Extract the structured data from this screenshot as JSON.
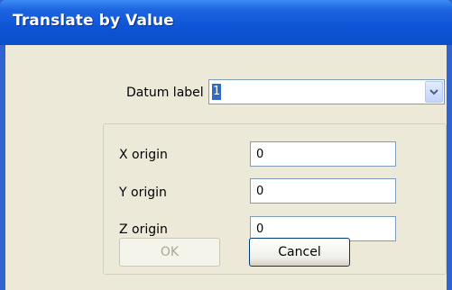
{
  "window": {
    "title": "Translate by Value"
  },
  "datum": {
    "label": "Datum label",
    "value": "1"
  },
  "origin": {
    "x_label": "X origin",
    "x_value": "0",
    "y_label": "Y origin",
    "y_value": "0",
    "z_label": "Z origin",
    "z_value": "0"
  },
  "buttons": {
    "ok_label": "OK",
    "cancel_label": "Cancel"
  },
  "icons": {
    "dropdown": "chevron-down-icon"
  },
  "colors": {
    "titlebar": "#0d55d6",
    "selection": "#316ac5",
    "dialog_bg": "#ece9d8"
  }
}
